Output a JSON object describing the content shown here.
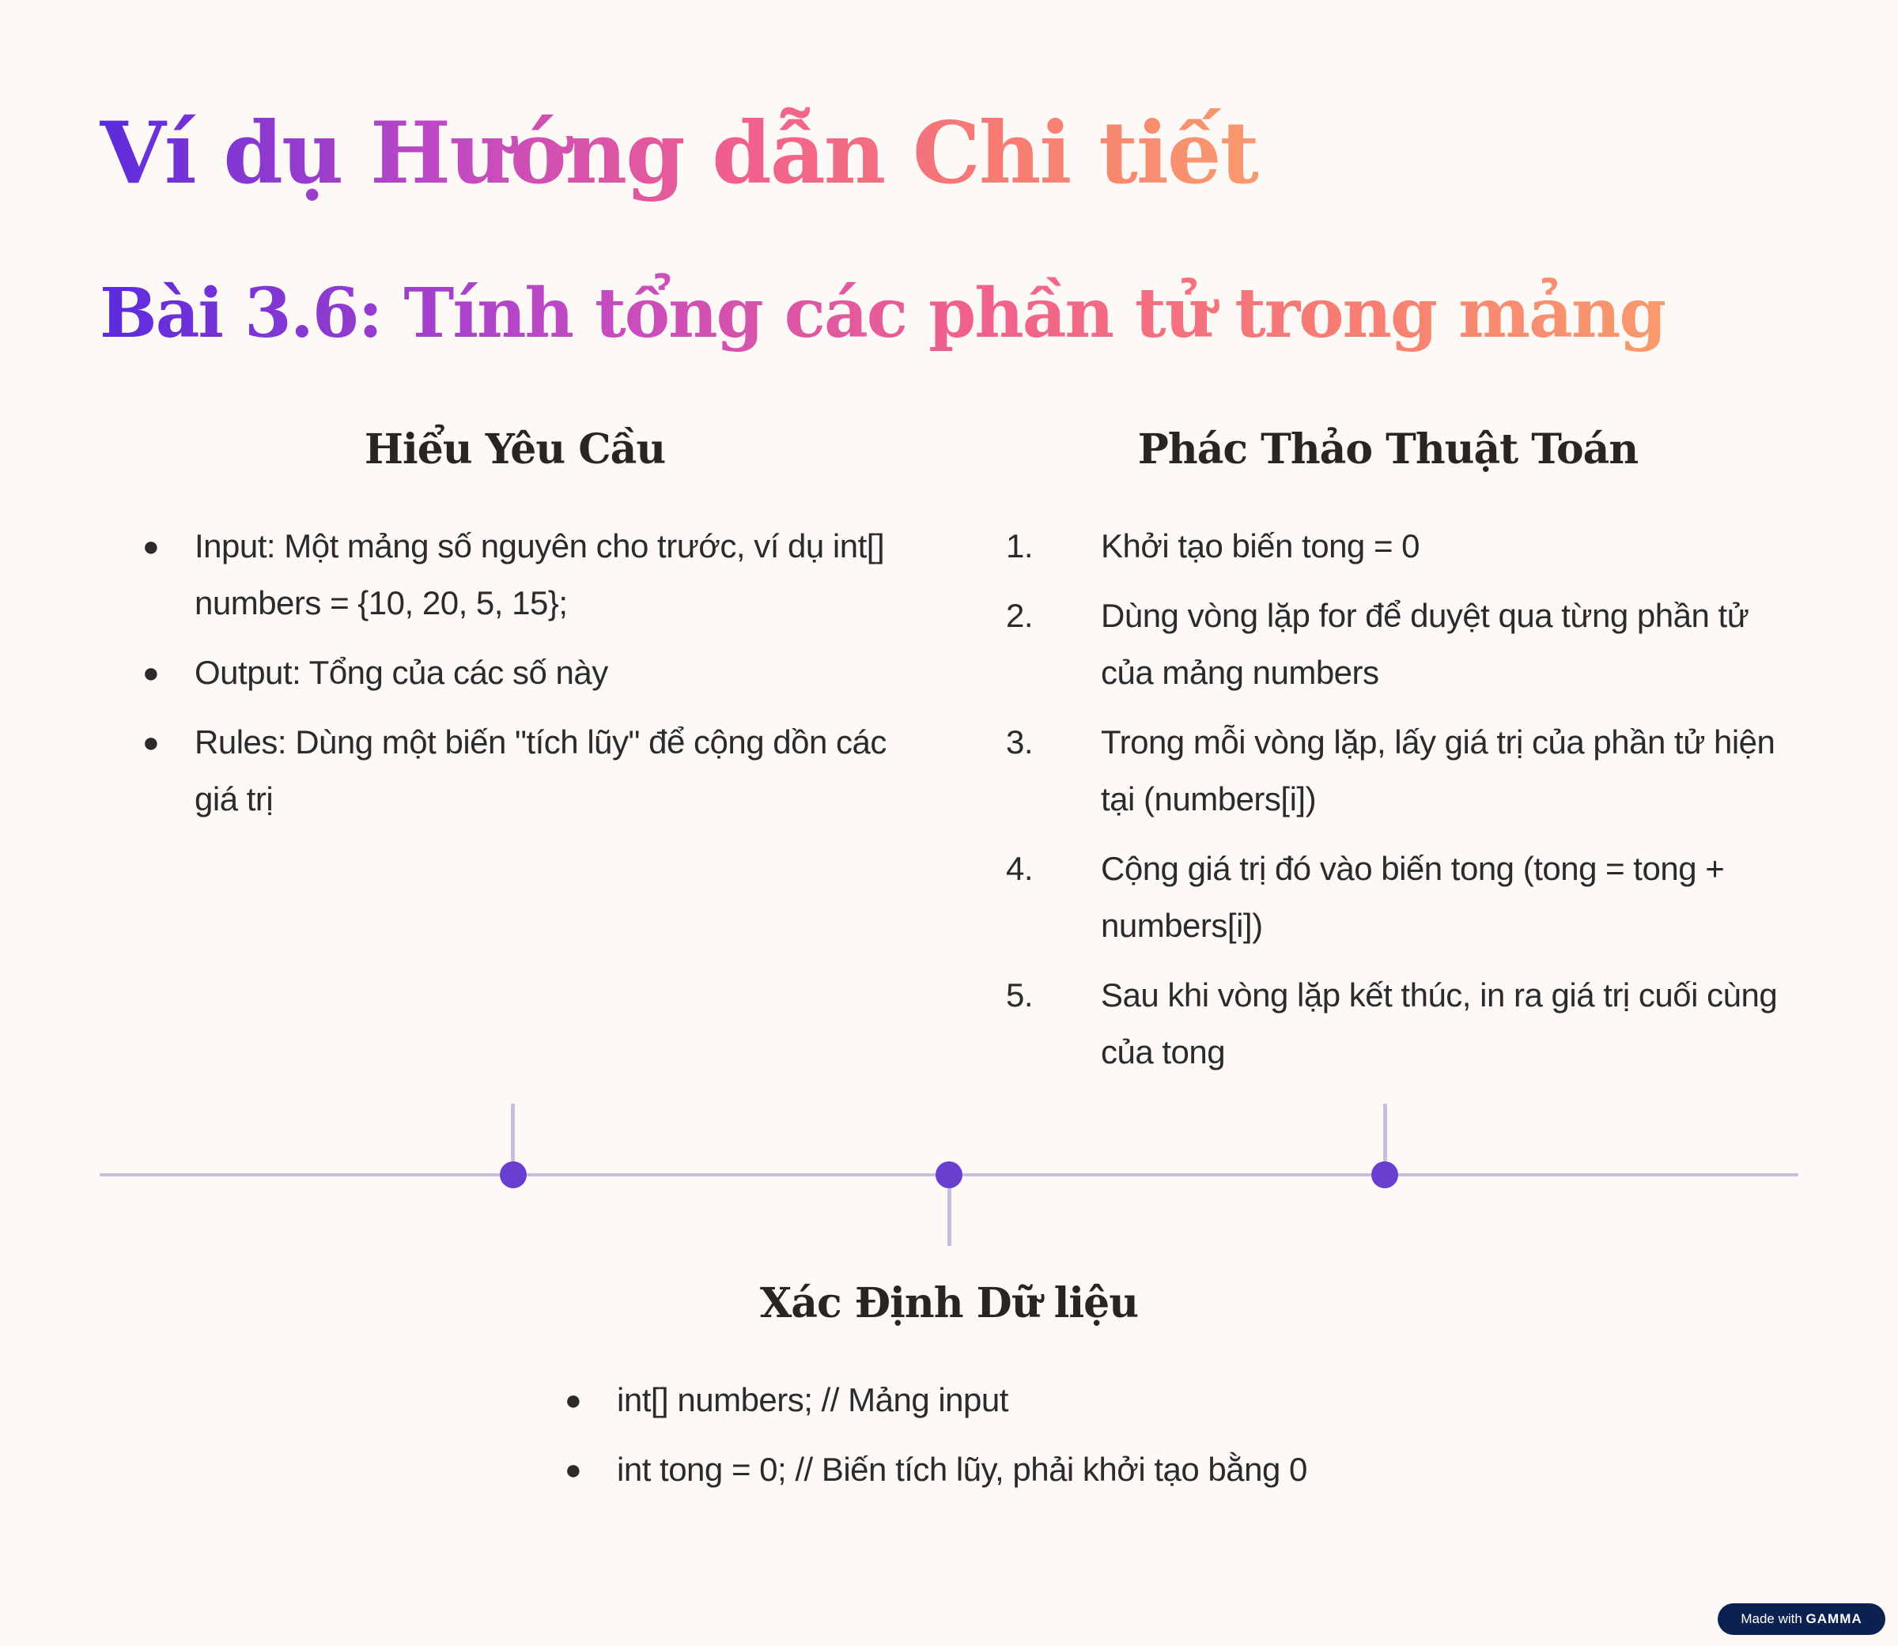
{
  "title": "Ví dụ Hướng dẫn Chi tiết",
  "subtitle": "Bài 3.6: Tính tổng các phần tử trong mảng",
  "sections": {
    "requirements": {
      "heading": "Hiểu Yêu Cầu",
      "items": [
        "Input: Một mảng số nguyên cho trước, ví dụ int[] numbers = {10, 20, 5, 15};",
        "Output: Tổng của các số này",
        "Rules: Dùng một biến \"tích lũy\" để cộng dồn các giá trị"
      ]
    },
    "algorithm": {
      "heading": "Phác Thảo Thuật Toán",
      "steps": [
        "Khởi tạo biến tong = 0",
        "Dùng vòng lặp for để duyệt qua từng phần tử của mảng numbers",
        "Trong mỗi vòng lặp, lấy giá trị của phần tử hiện tại (numbers[i])",
        "Cộng giá trị đó vào biến tong (tong = tong + numbers[i])",
        "Sau khi vòng lặp kết thúc, in ra giá trị cuối cùng của tong"
      ]
    },
    "data": {
      "heading": "Xác Định Dữ liệu",
      "items": [
        "int[] numbers; // Mảng input",
        "int tong = 0; // Biến tích lũy, phải khởi tạo bằng 0"
      ]
    }
  },
  "badge": {
    "prefix": "Made with",
    "brand": "GAMMA"
  },
  "colors": {
    "background": "#fcf9f7",
    "timeline": "#c6bedc",
    "dot": "#6a3fd0",
    "badge": "#0d2150"
  }
}
